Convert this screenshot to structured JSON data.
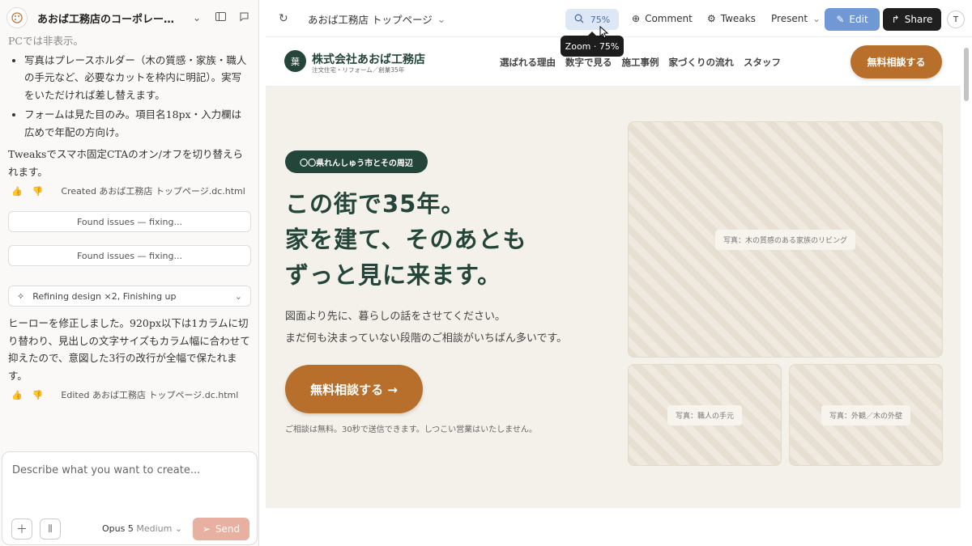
{
  "sidebar": {
    "title": "あおば工務店のコーポレート…",
    "chat": {
      "top_text": "PCでは非表示。",
      "bullets": [
        "写真はプレースホルダー（木の質感・家族・職人の手元など、必要なカットを枠内に明記）。実写をいただければ差し替えます。",
        "フォームは見た目のみ。項目名18px・入力欄は広めで年配の方向け。"
      ],
      "para1": "Tweaksでスマホ固定CTAのオン/オフを切り替えられます。",
      "created": "Created あおば工務店 トップページ.dc.html",
      "issue1": "Found issues — fixing...",
      "issue2": "Found issues — fixing...",
      "refining": "Refining design ×2, Finishing up",
      "para2": "ヒーローを修正しました。920px以下は1カラムに切り替わり、見出しの文字サイズもカラム幅に合わせて抑えたので、意図した3行の改行が全幅で保たれます。",
      "edited": "Edited あおば工務店 トップページ.dc.html"
    },
    "composer": {
      "placeholder": "Describe what you want to create...",
      "model": "Opus 5",
      "effort": "Medium",
      "send": "Send"
    }
  },
  "toolbar": {
    "page": "あおば工務店 トップページ",
    "zoom": "75%",
    "zoom_tooltip": "Zoom · 75%",
    "comment": "Comment",
    "tweaks": "Tweaks",
    "present": "Present",
    "edit": "Edit",
    "share": "Share",
    "avatar": "T"
  },
  "site": {
    "logo_mark": "葉",
    "company": "株式会社あおば工務店",
    "tagline": "注文住宅・リフォーム／創業35年",
    "nav": [
      "選ばれる理由",
      "数字で見る",
      "施工事例",
      "家づくりの流れ",
      "スタッフ"
    ],
    "nav_cta": "無料相談する",
    "badge": "〇〇県れんしゅう市とその周辺",
    "headline": [
      "この街で35年。",
      "家を建て、そのあとも",
      "ずっと見に来ます。"
    ],
    "subtext": [
      "図面より先に、暮らしの話をさせてください。",
      "まだ何も決まっていない段階のご相談がいちばん多いです。"
    ],
    "cta": "無料相談する →",
    "note": "ご相談は無料。30秒で送信できます。しつこい営業はいたしません。",
    "photos": [
      "写真：木の質感のある家族のリビング",
      "写真：職人の手元",
      "写真：外観／木の外壁"
    ]
  },
  "colors": {
    "brand_green": "#24453a",
    "accent_orange": "#b86f2b",
    "hero_bg": "#f4f1ea",
    "edit_blue": "#6f98d4"
  }
}
